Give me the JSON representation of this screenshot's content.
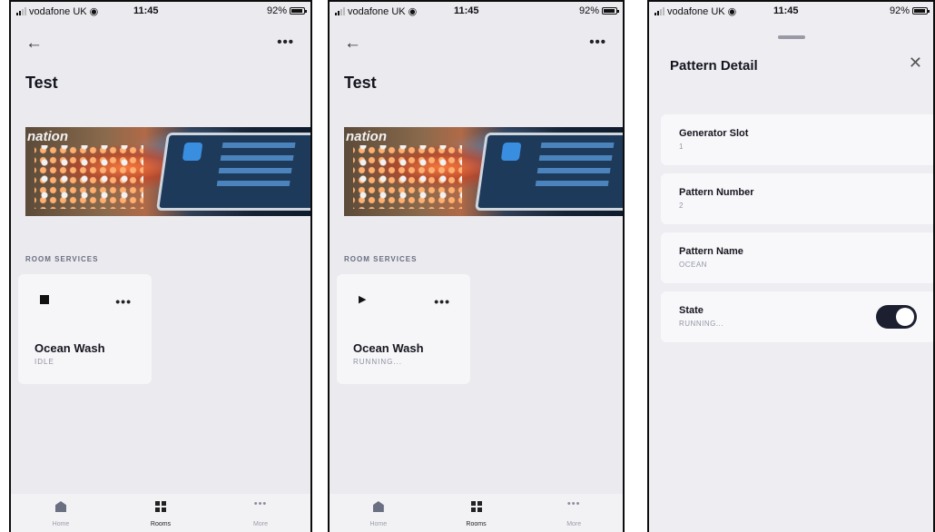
{
  "status_bar": {
    "carrier": "vodafone UK",
    "time": "11:45",
    "battery": "92%"
  },
  "colors": {
    "background": "#eaeaef",
    "card": "#f6f6f8",
    "text": "#15151f",
    "muted": "#8d90a0",
    "toggle_on": "#1c1f30"
  },
  "room_page": {
    "title": "Test",
    "image_overlay_text": "nation",
    "section_label": "ROOM SERVICES"
  },
  "screens": [
    {
      "service_name": "Ocean Wash",
      "service_status": "IDLE",
      "control_icon": "stop-icon"
    },
    {
      "service_name": "Ocean Wash",
      "service_status": "RUNNING...",
      "control_icon": "play-icon"
    }
  ],
  "tab_bar": {
    "tabs": [
      {
        "label": "Home",
        "icon": "home-icon",
        "active": false
      },
      {
        "label": "Rooms",
        "icon": "rooms-icon",
        "active": true
      },
      {
        "label": "More",
        "icon": "more-icon",
        "active": false
      }
    ]
  },
  "pattern_detail": {
    "title": "Pattern Detail",
    "fields": [
      {
        "label": "Generator Slot",
        "value": "1"
      },
      {
        "label": "Pattern Number",
        "value": "2"
      },
      {
        "label": "Pattern Name",
        "value": "OCEAN"
      },
      {
        "label": "State",
        "value": "RUNNING..."
      }
    ],
    "state_toggle_on": true
  }
}
